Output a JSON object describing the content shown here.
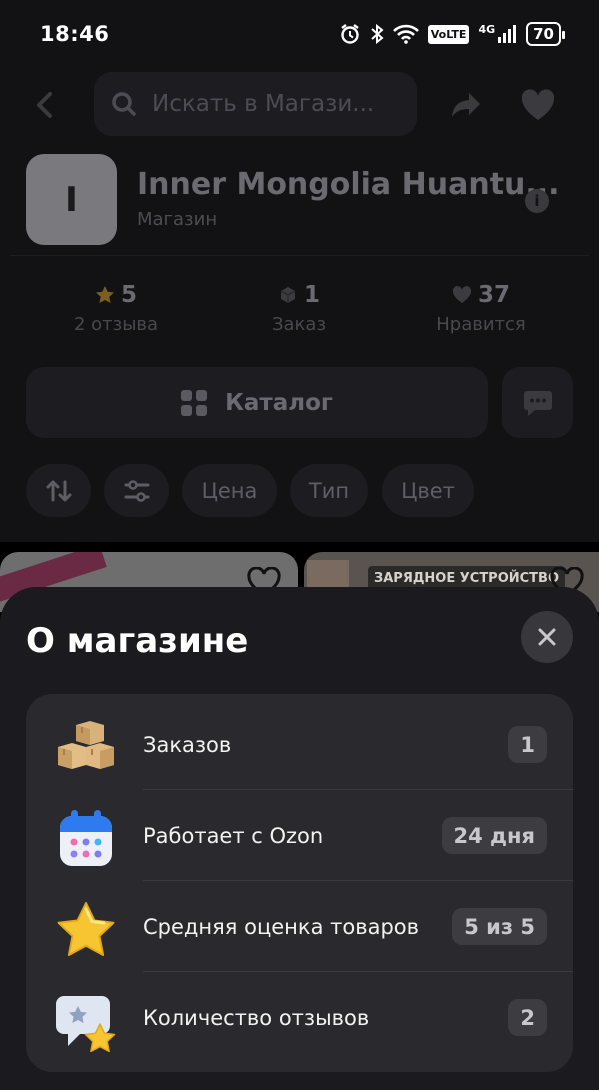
{
  "status_bar": {
    "time": "18:46",
    "icons": [
      "alarm-icon",
      "bluetooth-icon",
      "wifi-icon",
      "volte-icon",
      "signal-4g-icon",
      "battery-icon"
    ],
    "volte": "VoLTE",
    "network": "4G",
    "battery": "70"
  },
  "header": {
    "search_placeholder": "Искать в Магази..."
  },
  "store": {
    "logo_letter": "I",
    "name": "Inner Mongolia Huantu...",
    "type": "Магазин"
  },
  "stats": [
    {
      "value": "5",
      "label": "2 отзыва",
      "icon": "star-icon"
    },
    {
      "value": "1",
      "label": "Заказ",
      "icon": "box-icon"
    },
    {
      "value": "37",
      "label": "Нравится",
      "icon": "heart-icon"
    }
  ],
  "catalog": {
    "label": "Каталог"
  },
  "filters": {
    "chips": [
      "Цена",
      "Тип",
      "Цвет"
    ]
  },
  "product_cards": {
    "right_badge": "ЗАРЯДНОЕ УСТРОЙСТВО"
  },
  "sheet": {
    "title": "О магазине",
    "rows": [
      {
        "label": "Заказов",
        "value": "1",
        "icon": "boxes-icon"
      },
      {
        "label": "Работает с Ozon",
        "value": "24 дня",
        "icon": "calendar-icon"
      },
      {
        "label": "Средняя оценка товаров",
        "value": "5 из 5",
        "icon": "star-icon"
      },
      {
        "label": "Количество отзывов",
        "value": "2",
        "icon": "review-icon"
      }
    ]
  },
  "colors": {
    "sheet_bg": "#1b1b1f",
    "card_bg": "#2a2a2e",
    "badge_bg": "#3c3c41",
    "dimmed_bg": "#121214"
  }
}
